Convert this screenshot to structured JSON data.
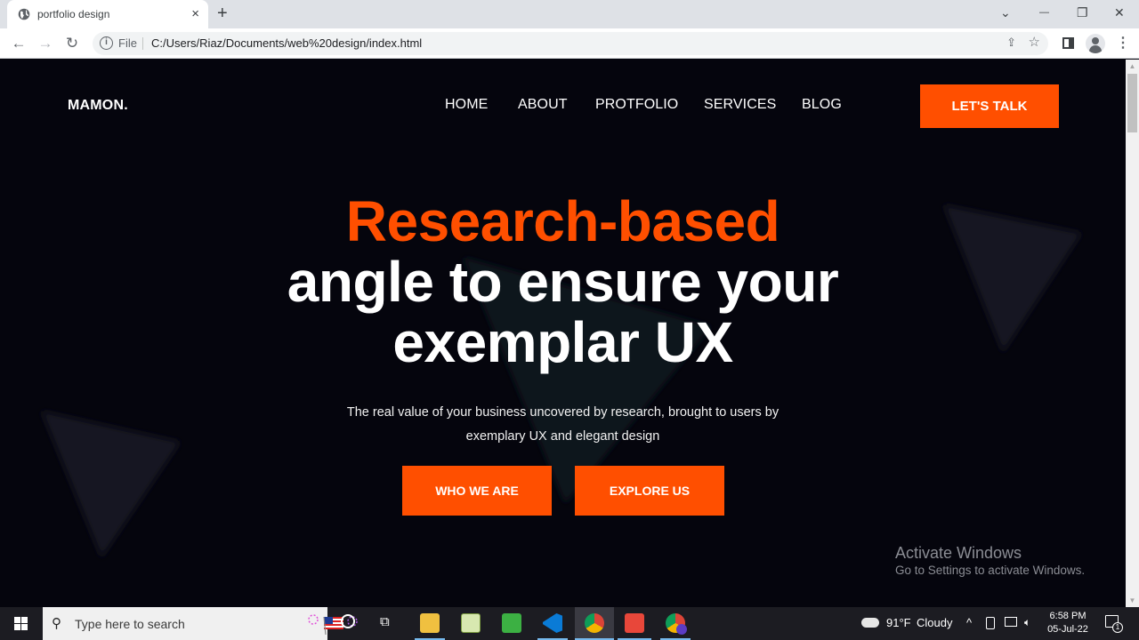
{
  "browser": {
    "tab_title": "portfolio design",
    "tab_close": "×",
    "new_tab": "+",
    "window_controls": {
      "tab_search": "⌄",
      "minimize": "—",
      "restore": "❐",
      "close": "✕"
    },
    "nav": {
      "back": "←",
      "forward": "→",
      "reload": "↻"
    },
    "omnibox": {
      "info_icon": "i",
      "scheme": "File",
      "url": "C:/Users/Riaz/Documents/web%20design/index.html",
      "share_icon": "⇪",
      "star_icon": "☆"
    },
    "menu_icon": "⋮"
  },
  "page": {
    "logo": "MAMON.",
    "nav": [
      "HOME",
      "ABOUT",
      "PROTFOLIO",
      "SERVICES",
      "BLOG"
    ],
    "cta_talk": "LET'S TALK",
    "hero": {
      "accent_line": "Research-based",
      "line2": "angle to ensure your",
      "line3": "exemplar UX"
    },
    "subtitle_line1": "The real value of your business uncovered by research, brought to users by",
    "subtitle_line2": "exemplary UX and elegant design",
    "buttons": {
      "primary": "WHO WE ARE",
      "secondary": "EXPLORE US"
    },
    "colors": {
      "accent": "#ff4f00",
      "background": "#05050d",
      "shape": "#141722"
    }
  },
  "watermark": {
    "title": "Activate Windows",
    "subtitle": "Go to Settings to activate Windows."
  },
  "scrollbar": {
    "up": "▲",
    "down": "▼"
  },
  "taskbar": {
    "search_placeholder": "Type here to search",
    "search_icon": "⚲",
    "task_view_icon": "⧉",
    "cortana_icon": "○",
    "weather": {
      "temp": "91°F",
      "condition": "Cloudy"
    },
    "tray_overflow": "^",
    "clock": {
      "time": "6:58 PM",
      "date": "05-Jul-22"
    },
    "notification_count": "1",
    "apps": [
      "File Explorer",
      "Notepad++",
      "Camtasia",
      "Visual Studio Code",
      "Google Chrome",
      "Camtasia Recorder",
      "Google Chrome Profile R"
    ]
  }
}
